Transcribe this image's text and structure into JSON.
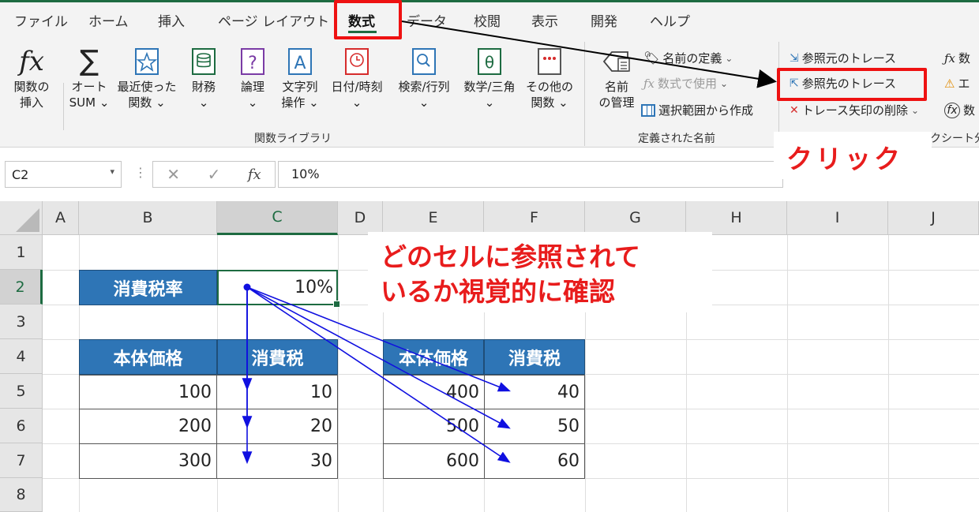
{
  "ribbon_tabs": [
    "ファイル",
    "ホーム",
    "挿入",
    "ページ レイアウト",
    "数式",
    "データ",
    "校閲",
    "表示",
    "開発",
    "ヘルプ"
  ],
  "active_tab": "数式",
  "function_library": {
    "insert_function": [
      "関数の",
      "挿入"
    ],
    "autosum": [
      "オート",
      "SUM ⌄"
    ],
    "recent": [
      "最近使った",
      "関数 ⌄"
    ],
    "financial": [
      "財務",
      "⌄"
    ],
    "logical": [
      "論理",
      "⌄"
    ],
    "text": [
      "文字列",
      "操作 ⌄"
    ],
    "datetime": [
      "日付/時刻",
      "⌄"
    ],
    "lookup": [
      "検索/行列",
      "⌄"
    ],
    "math": [
      "数学/三角",
      "⌄"
    ],
    "more": [
      "その他の",
      "関数 ⌄"
    ],
    "group_label": "関数ライブラリ"
  },
  "defined_names": {
    "name_manager": [
      "名前",
      "の管理"
    ],
    "define_name": "名前の定義",
    "use_in_formula": "数式で使用",
    "create_from_selection": "選択範囲から作成",
    "group_label": "定義された名前"
  },
  "formula_auditing": {
    "trace_precedents": "参照元のトレース",
    "trace_dependents": "参照先のトレース",
    "remove_arrows": "トレース矢印の削除",
    "right_1": "数",
    "right_2": "エ",
    "right_3": "数",
    "group_label_partial": "クシート分"
  },
  "formula_bar": {
    "name_box": "C2",
    "formula": "10%"
  },
  "columns": [
    "A",
    "B",
    "C",
    "D",
    "E",
    "F",
    "G",
    "H",
    "I",
    "J"
  ],
  "rows": [
    "1",
    "2",
    "3",
    "4",
    "5",
    "6",
    "7",
    "8"
  ],
  "sheet": {
    "tax_rate_label": "消費税率",
    "tax_rate_value": "10%",
    "table1_headers": [
      "本体価格",
      "消費税"
    ],
    "table1_rows": [
      [
        "100",
        "10"
      ],
      [
        "200",
        "20"
      ],
      [
        "300",
        "30"
      ]
    ],
    "table2_headers": [
      "本体価格",
      "消費税"
    ],
    "table2_rows": [
      [
        "400",
        "40"
      ],
      [
        "500",
        "50"
      ],
      [
        "600",
        "60"
      ]
    ]
  },
  "annotations": {
    "click_text": "クリック",
    "note_line1": "どのセルに参照されて",
    "note_line2": "いるか視覚的に確認",
    "highlight_color": "#ee1111",
    "arrow_color": "#1010e0"
  }
}
